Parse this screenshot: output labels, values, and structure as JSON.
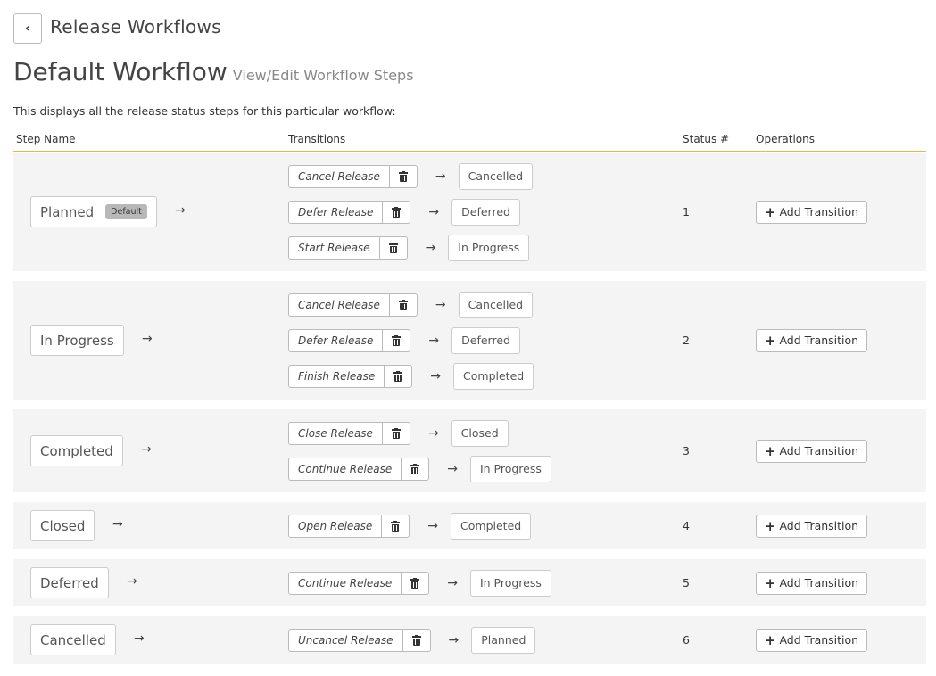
{
  "header": {
    "back_icon": "chevron-left-icon",
    "back_label": "Release Workflows",
    "title": "Default Workflow",
    "subtitle": "View/Edit Workflow Steps",
    "description": "This displays all the release status steps for this particular workflow:"
  },
  "columns": {
    "step_name": "Step Name",
    "transitions": "Transitions",
    "status_num": "Status #",
    "operations": "Operations"
  },
  "add_transition_label": "Add Transition",
  "rows": [
    {
      "step": "Planned",
      "badge": "Default",
      "status": "1",
      "transitions": [
        {
          "name": "Cancel Release",
          "target": "Cancelled"
        },
        {
          "name": "Defer Release",
          "target": "Deferred"
        },
        {
          "name": "Start Release",
          "target": "In Progress"
        }
      ]
    },
    {
      "step": "In Progress",
      "badge": "",
      "status": "2",
      "transitions": [
        {
          "name": "Cancel Release",
          "target": "Cancelled"
        },
        {
          "name": "Defer Release",
          "target": "Deferred"
        },
        {
          "name": "Finish Release",
          "target": "Completed"
        }
      ]
    },
    {
      "step": "Completed",
      "badge": "",
      "status": "3",
      "transitions": [
        {
          "name": "Close Release",
          "target": "Closed"
        },
        {
          "name": "Continue Release",
          "target": "In Progress"
        }
      ]
    },
    {
      "step": "Closed",
      "badge": "",
      "status": "4",
      "transitions": [
        {
          "name": "Open Release",
          "target": "Completed"
        }
      ]
    },
    {
      "step": "Deferred",
      "badge": "",
      "status": "5",
      "transitions": [
        {
          "name": "Continue Release",
          "target": "In Progress"
        }
      ]
    },
    {
      "step": "Cancelled",
      "badge": "",
      "status": "6",
      "transitions": [
        {
          "name": "Uncancel Release",
          "target": "Planned"
        }
      ]
    }
  ]
}
